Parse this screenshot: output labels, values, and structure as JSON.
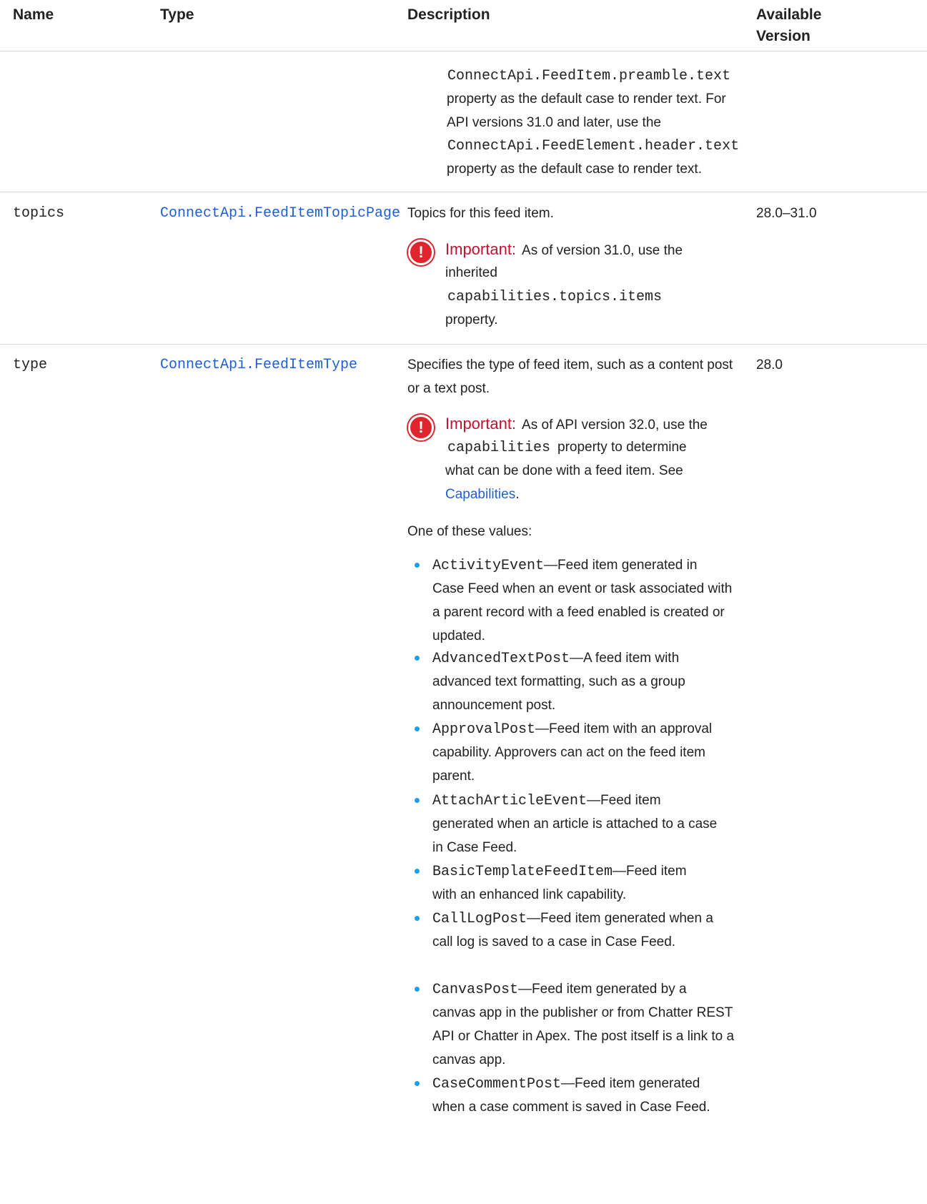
{
  "header": {
    "name": "Name",
    "type": "Type",
    "description": "Description",
    "available_line1": "Available",
    "available_line2": "Version"
  },
  "row_preamble": {
    "code1": "ConnectApi.FeedItem.preamble.text",
    "text1": "property as the default case to render text. For",
    "text2": "API versions 31.0 and later, use the",
    "code2": "ConnectApi.FeedElement.header.text",
    "text3": "property as the default case to render text."
  },
  "row_topics": {
    "name": "topics",
    "type": "ConnectApi.FeedItemTopicPage",
    "description": "Topics for this feed item.",
    "version": "28.0–31.0",
    "important_label": "Important:",
    "important_line1": "As of version 31.0, use the",
    "important_line2": "inherited",
    "important_code": "capabilities.topics.items",
    "important_line3": "property.",
    "icon": "important-icon"
  },
  "row_type": {
    "name": "type",
    "type": "ConnectApi.FeedItemType",
    "description_line1": "Specifies the type of feed item, such as a content post",
    "description_line2": "or a text post.",
    "version": "28.0",
    "important_label": "Important:",
    "important_line1": "As of API version 32.0, use the",
    "important_code": "capabilities",
    "important_line2": "property to determine",
    "important_line3": "what can be done with a feed item. See",
    "important_link": "Capabilities",
    "important_link_end": ".",
    "values_intro": "One of these values:",
    "values": [
      {
        "code": "ActivityEvent",
        "lines": [
          "—Feed item generated in",
          "Case Feed when an event or task associated with",
          "a parent record with a feed enabled is created or",
          "updated."
        ]
      },
      {
        "code": "AdvancedTextPost",
        "lines": [
          "—A feed item with",
          "advanced text formatting, such as a group",
          "announcement post."
        ]
      },
      {
        "code": "ApprovalPost",
        "lines": [
          "—Feed item with an approval",
          "capability. Approvers can act on the feed item",
          "parent."
        ]
      },
      {
        "code": "AttachArticleEvent",
        "lines": [
          "—Feed item",
          "generated when an article is attached to a case",
          "in Case Feed."
        ]
      },
      {
        "code": "BasicTemplateFeedItem",
        "lines": [
          "—Feed item",
          "with an enhanced link capability."
        ]
      },
      {
        "code": "CallLogPost",
        "lines": [
          "—Feed item generated when a",
          "call log is saved to a case in Case Feed."
        ]
      },
      {
        "code": "CanvasPost",
        "lines": [
          "—Feed item generated by a",
          "canvas app in the publisher or from Chatter REST",
          "API or Chatter in Apex. The post itself is a link to a",
          "canvas app."
        ]
      },
      {
        "code": "CaseCommentPost",
        "lines": [
          "—Feed item generated",
          "when a case comment is saved in Case Feed."
        ]
      }
    ]
  },
  "colors": {
    "link": "#1f5fd6",
    "important": "#c8102e",
    "bullet": "#1ea1e0",
    "rule": "#d6d6d6"
  }
}
